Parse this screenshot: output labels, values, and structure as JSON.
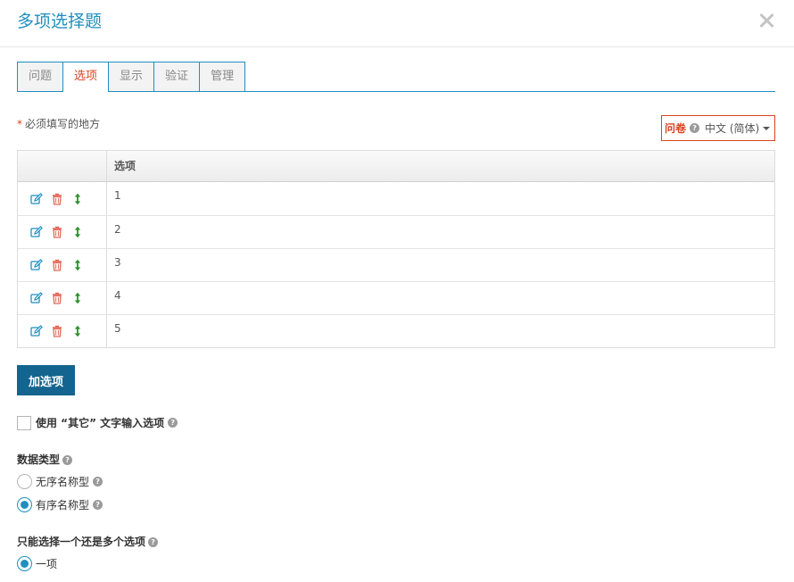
{
  "dialog": {
    "title": "多项选择题"
  },
  "tabs": [
    {
      "label": "问题"
    },
    {
      "label": "选项"
    },
    {
      "label": "显示"
    },
    {
      "label": "验证"
    },
    {
      "label": "管理"
    }
  ],
  "required_note": {
    "star": "*",
    "text": "必须填写的地方"
  },
  "language": {
    "label": "问卷",
    "value": "中文 (简体)"
  },
  "options_table": {
    "header": "选项",
    "rows": [
      "1",
      "2",
      "3",
      "4",
      "5"
    ]
  },
  "add_option_button": "加选项",
  "other_option": {
    "label": "使用 “其它” 文字输入选项",
    "checked": false
  },
  "data_type": {
    "label": "数据类型",
    "options": [
      {
        "label": "无序名称型",
        "checked": false
      },
      {
        "label": "有序名称型",
        "checked": true
      }
    ]
  },
  "selection_mode": {
    "label": "只能选择一个还是多个选项",
    "options": [
      {
        "label": "一项",
        "checked": true
      }
    ]
  },
  "colors": {
    "accent": "#1f8fbf",
    "active_tab": "#d9441f",
    "button": "#13658f",
    "edit_icon": "#1f8fbf",
    "delete_icon": "#e2675a",
    "move_icon": "#2f8f2f"
  }
}
